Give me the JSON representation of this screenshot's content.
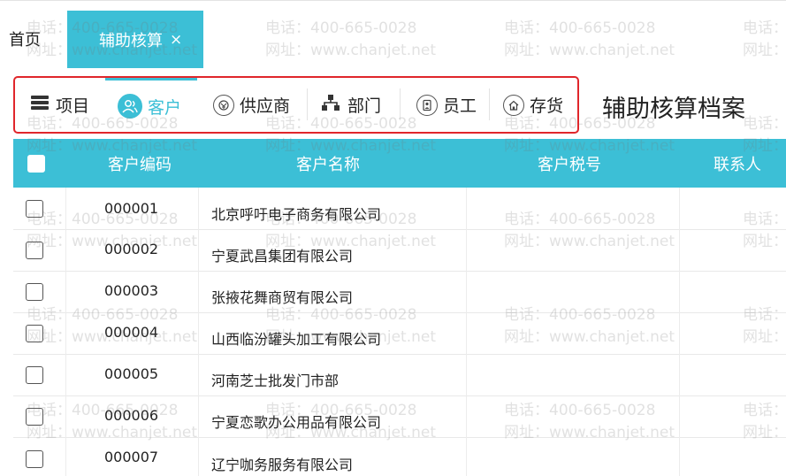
{
  "tabs": {
    "home": "首页",
    "active": "辅助核算",
    "close": "×"
  },
  "categories": [
    {
      "label": "项目",
      "icon": "list-icon"
    },
    {
      "label": "客户",
      "icon": "people-icon"
    },
    {
      "label": "供应商",
      "icon": "supplier-icon"
    },
    {
      "label": "部门",
      "icon": "org-chart-icon"
    },
    {
      "label": "员工",
      "icon": "id-badge-icon"
    },
    {
      "label": "存货",
      "icon": "house-icon"
    }
  ],
  "page_title": "辅助核算档案",
  "table": {
    "headers": [
      "客户编码",
      "客户名称",
      "客户税号",
      "联系人"
    ],
    "rows": [
      {
        "code": "000001",
        "name": "北京呼吁电子商务有限公司"
      },
      {
        "code": "000002",
        "name": "宁夏武昌集团有限公司"
      },
      {
        "code": "000003",
        "name": "张掖花舞商贸有限公司"
      },
      {
        "code": "000004",
        "name": "山西临汾罐头加工有限公司"
      },
      {
        "code": "000005",
        "name": "河南芝士批发门市部"
      },
      {
        "code": "000006",
        "name": "宁夏恋歌办公用品有限公司"
      },
      {
        "code": "000007",
        "name": "辽宁咖务服务有限公司"
      }
    ]
  },
  "watermark": {
    "phone": "电话：400-665-0028",
    "site": "网址：www.chanjet.net"
  },
  "colors": {
    "accent": "#3cbfd6",
    "highlight_border": "#e0262b"
  }
}
